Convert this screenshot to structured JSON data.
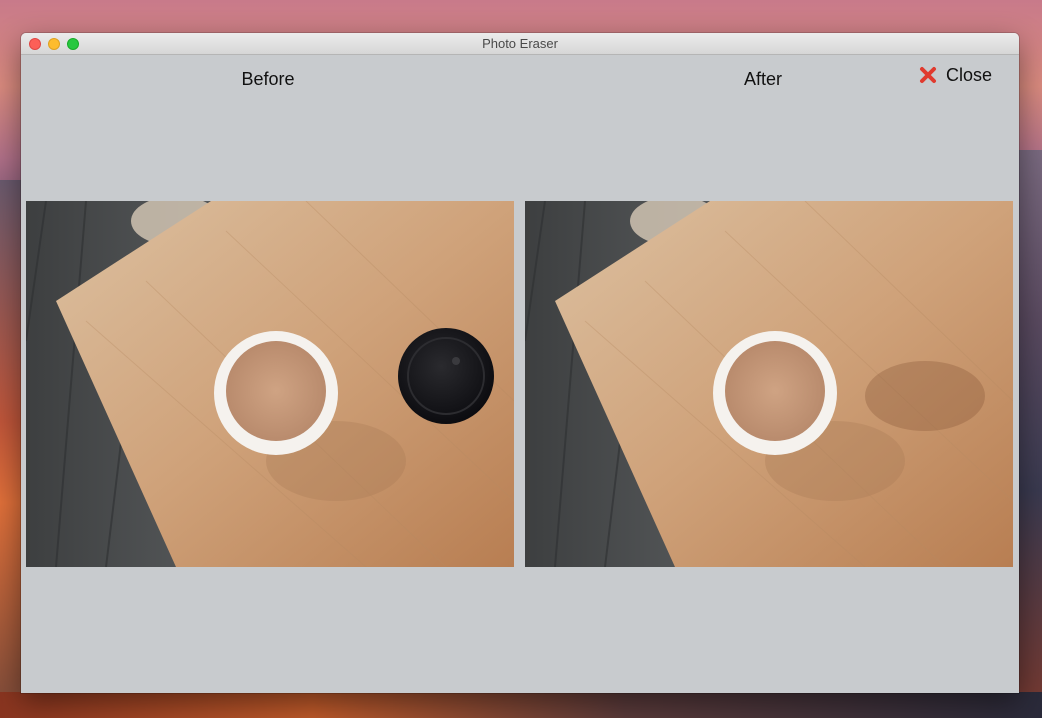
{
  "window": {
    "title": "Photo Eraser"
  },
  "labels": {
    "before": "Before",
    "after": "After"
  },
  "close_button": {
    "label": "Close",
    "icon": "x-icon",
    "color": "#e03a2e"
  },
  "panels": [
    {
      "name": "before",
      "shows_lid": true
    },
    {
      "name": "after",
      "shows_lid": false
    }
  ],
  "colors": {
    "window_bg": "#c8cbce",
    "wood_table": "#c49770",
    "floor": "#4a4e52"
  }
}
